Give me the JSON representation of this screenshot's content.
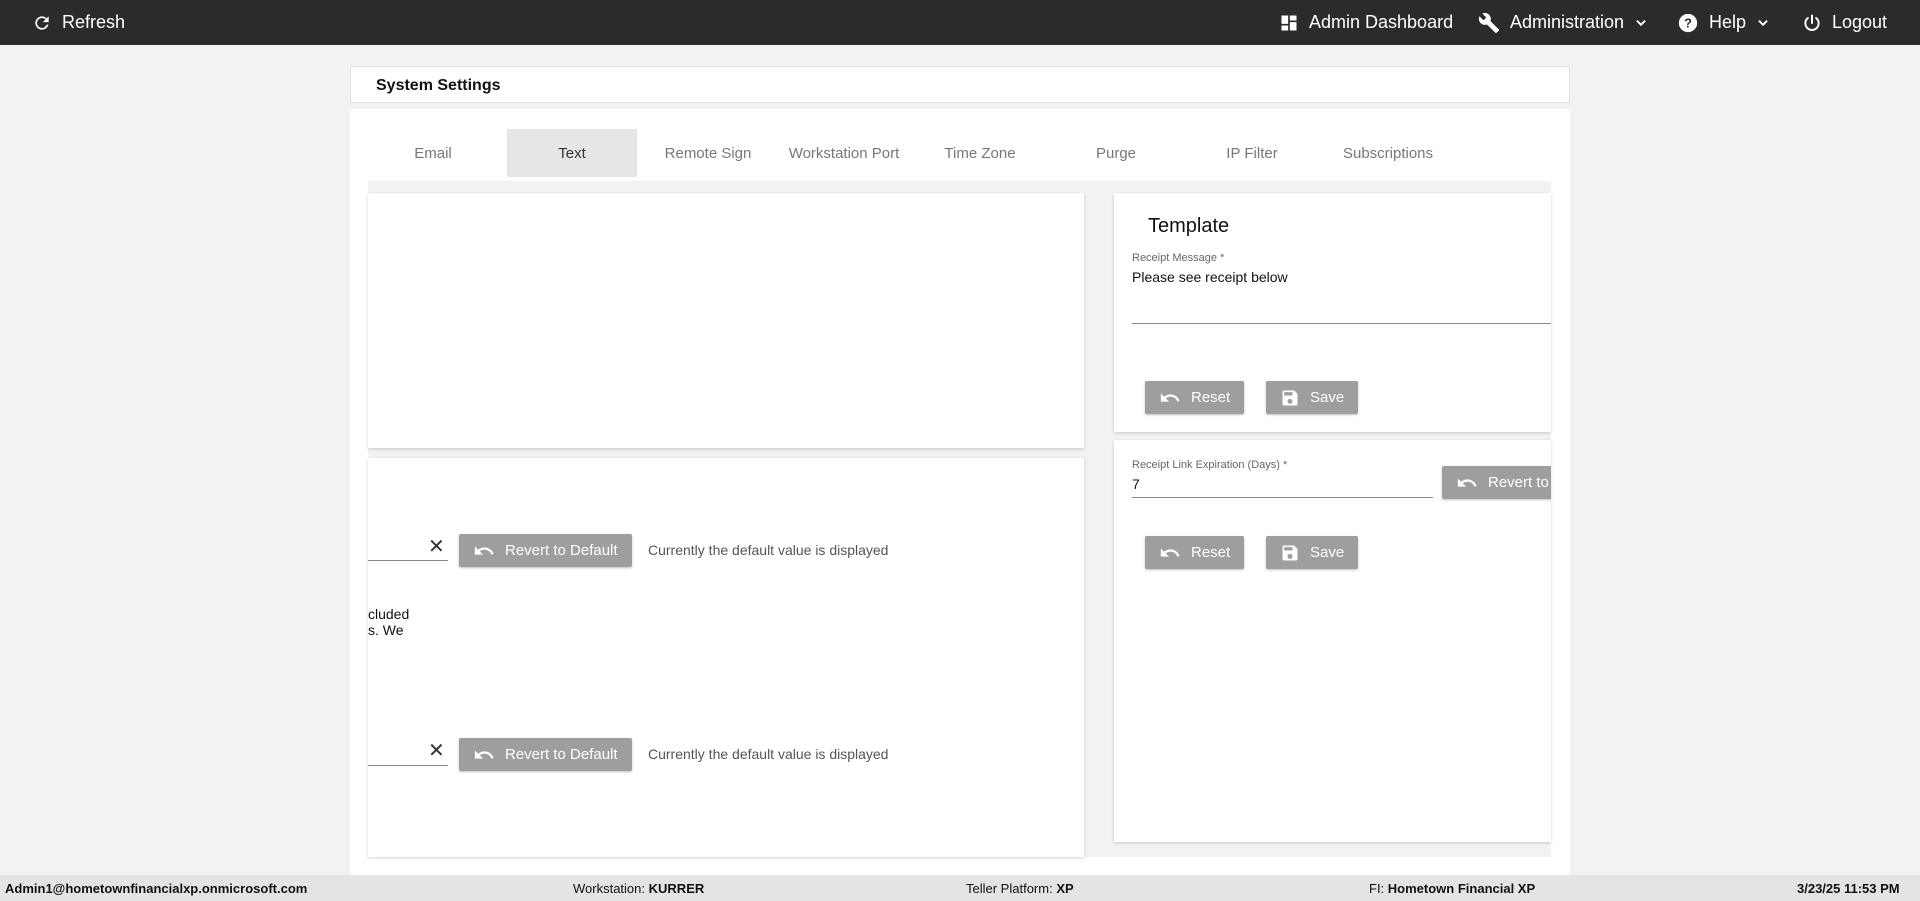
{
  "topbar": {
    "refresh_label": "Refresh",
    "admin_dashboard_label": "Admin Dashboard",
    "administration_label": "Administration",
    "help_label": "Help",
    "logout_label": "Logout"
  },
  "page_title": "System Settings",
  "tabs": [
    {
      "label": "Email"
    },
    {
      "label": "Text"
    },
    {
      "label": "Remote Sign"
    },
    {
      "label": "Workstation Port"
    },
    {
      "label": "Time Zone"
    },
    {
      "label": "Purge"
    },
    {
      "label": "IP Filter"
    },
    {
      "label": "Subscriptions"
    }
  ],
  "active_tab": "Text",
  "left_panel": {
    "row1": {
      "revert_label": "Revert to Default",
      "status": "Currently the default value is displayed"
    },
    "clipped_text_line1": "cluded",
    "clipped_text_line2": "s. We",
    "row2": {
      "revert_label": "Revert to Default",
      "status": "Currently the default value is displayed"
    }
  },
  "template_panel": {
    "title": "Template",
    "receipt_message_label": "Receipt Message *",
    "receipt_message_value": "Please see receipt below",
    "reset_label": "Reset",
    "save_label": "Save"
  },
  "expiration_panel": {
    "label": "Receipt Link Expiration (Days) *",
    "value": "7",
    "revert_label": "Revert to",
    "reset_label": "Reset",
    "save_label": "Save"
  },
  "footer": {
    "user": "Admin1@hometownfinancialxp.onmicrosoft.com",
    "workstation_label": "Workstation:",
    "workstation_value": "KURRER",
    "teller_platform_label": "Teller Platform:",
    "teller_platform_value": "XP",
    "fi_label": "FI:",
    "fi_value": "Hometown Financial XP",
    "datetime": "3/23/25 11:53 PM"
  }
}
